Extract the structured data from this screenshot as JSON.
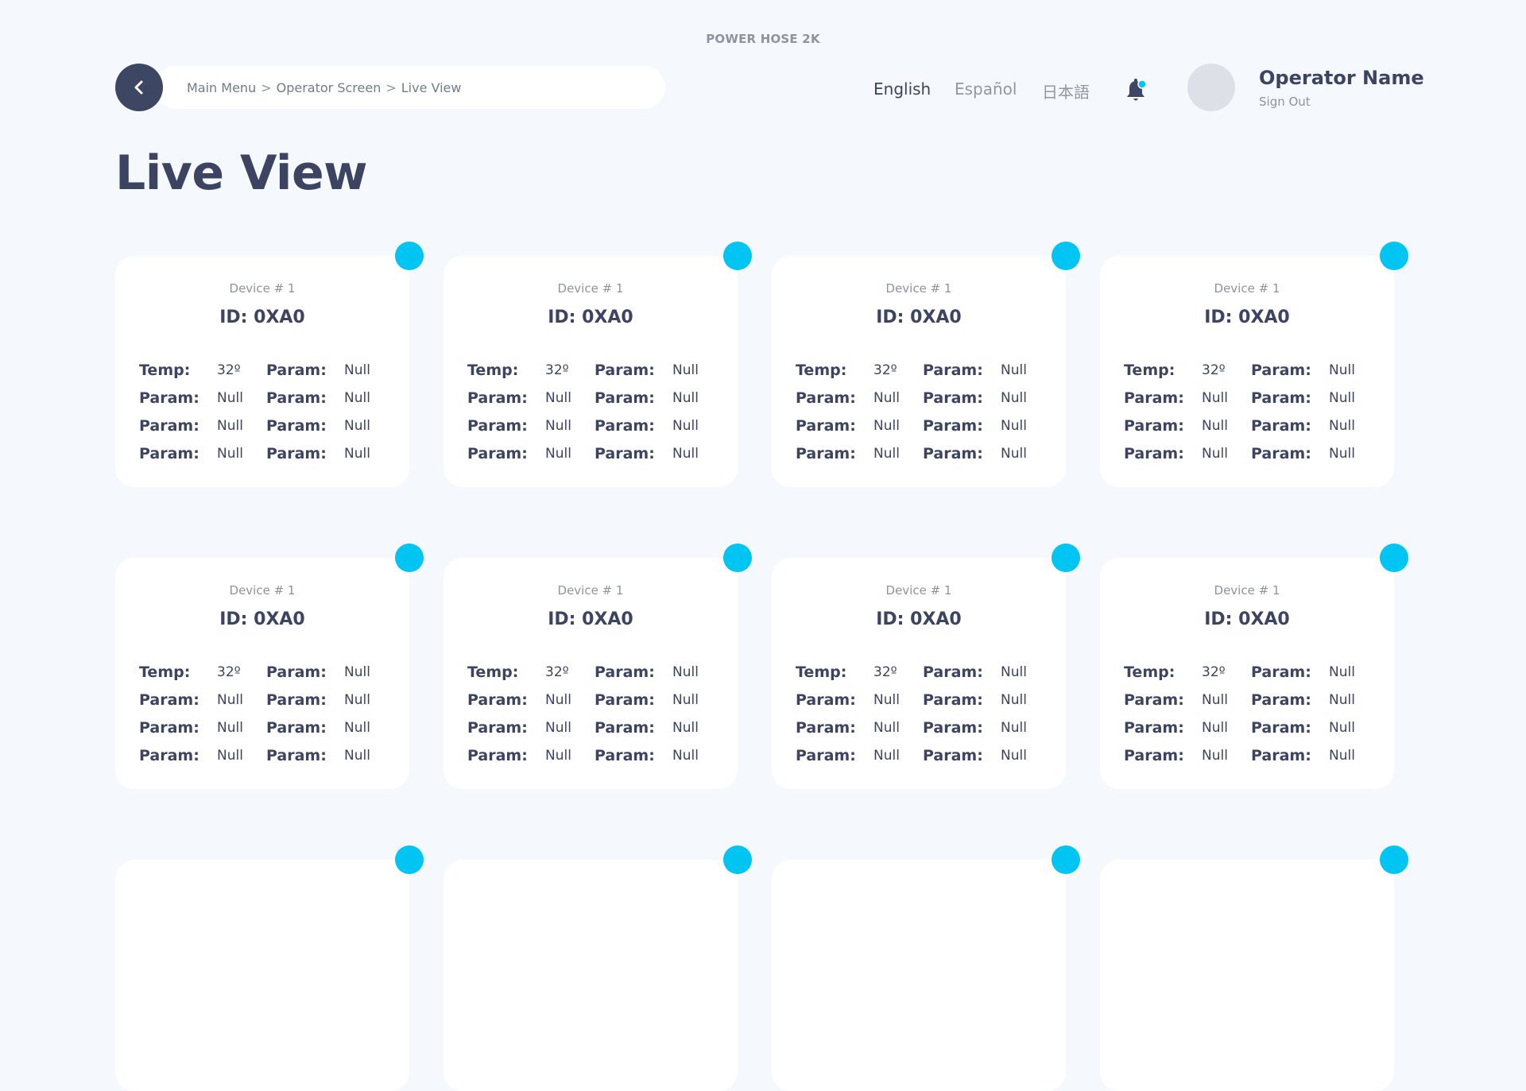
{
  "app": {
    "title": "POWER HOSE 2K"
  },
  "breadcrumb": {
    "items": [
      "Main Menu",
      "Operator Screen",
      "Live View"
    ],
    "separator": ">"
  },
  "languages": [
    {
      "label": "English",
      "active": true
    },
    {
      "label": "Español",
      "active": false
    },
    {
      "label": "日本語",
      "active": false
    }
  ],
  "user": {
    "name": "Operator Name",
    "sign_out": "Sign Out"
  },
  "page": {
    "title": "Live View"
  },
  "colors": {
    "accent": "#00c4f2",
    "primary": "#3d4663",
    "background": "#f5f8fc"
  },
  "devices": [
    {
      "label": "Device # 1",
      "id": "ID: 0XA0",
      "rows": [
        [
          "Temp:",
          "32º",
          "Param:",
          "Null"
        ],
        [
          "Param:",
          "Null",
          "Param:",
          "Null"
        ],
        [
          "Param:",
          "Null",
          "Param:",
          "Null"
        ],
        [
          "Param:",
          "Null",
          "Param:",
          "Null"
        ]
      ]
    },
    {
      "label": "Device # 1",
      "id": "ID: 0XA0",
      "rows": [
        [
          "Temp:",
          "32º",
          "Param:",
          "Null"
        ],
        [
          "Param:",
          "Null",
          "Param:",
          "Null"
        ],
        [
          "Param:",
          "Null",
          "Param:",
          "Null"
        ],
        [
          "Param:",
          "Null",
          "Param:",
          "Null"
        ]
      ]
    },
    {
      "label": "Device # 1",
      "id": "ID: 0XA0",
      "rows": [
        [
          "Temp:",
          "32º",
          "Param:",
          "Null"
        ],
        [
          "Param:",
          "Null",
          "Param:",
          "Null"
        ],
        [
          "Param:",
          "Null",
          "Param:",
          "Null"
        ],
        [
          "Param:",
          "Null",
          "Param:",
          "Null"
        ]
      ]
    },
    {
      "label": "Device # 1",
      "id": "ID: 0XA0",
      "rows": [
        [
          "Temp:",
          "32º",
          "Param:",
          "Null"
        ],
        [
          "Param:",
          "Null",
          "Param:",
          "Null"
        ],
        [
          "Param:",
          "Null",
          "Param:",
          "Null"
        ],
        [
          "Param:",
          "Null",
          "Param:",
          "Null"
        ]
      ]
    },
    {
      "label": "Device # 1",
      "id": "ID: 0XA0",
      "rows": [
        [
          "Temp:",
          "32º",
          "Param:",
          "Null"
        ],
        [
          "Param:",
          "Null",
          "Param:",
          "Null"
        ],
        [
          "Param:",
          "Null",
          "Param:",
          "Null"
        ],
        [
          "Param:",
          "Null",
          "Param:",
          "Null"
        ]
      ]
    },
    {
      "label": "Device # 1",
      "id": "ID: 0XA0",
      "rows": [
        [
          "Temp:",
          "32º",
          "Param:",
          "Null"
        ],
        [
          "Param:",
          "Null",
          "Param:",
          "Null"
        ],
        [
          "Param:",
          "Null",
          "Param:",
          "Null"
        ],
        [
          "Param:",
          "Null",
          "Param:",
          "Null"
        ]
      ]
    },
    {
      "label": "Device # 1",
      "id": "ID: 0XA0",
      "rows": [
        [
          "Temp:",
          "32º",
          "Param:",
          "Null"
        ],
        [
          "Param:",
          "Null",
          "Param:",
          "Null"
        ],
        [
          "Param:",
          "Null",
          "Param:",
          "Null"
        ],
        [
          "Param:",
          "Null",
          "Param:",
          "Null"
        ]
      ]
    },
    {
      "label": "Device # 1",
      "id": "ID: 0XA0",
      "rows": [
        [
          "Temp:",
          "32º",
          "Param:",
          "Null"
        ],
        [
          "Param:",
          "Null",
          "Param:",
          "Null"
        ],
        [
          "Param:",
          "Null",
          "Param:",
          "Null"
        ],
        [
          "Param:",
          "Null",
          "Param:",
          "Null"
        ]
      ]
    },
    {
      "label": "",
      "id": "",
      "rows": []
    },
    {
      "label": "",
      "id": "",
      "rows": []
    },
    {
      "label": "",
      "id": "",
      "rows": []
    },
    {
      "label": "",
      "id": "",
      "rows": []
    }
  ]
}
